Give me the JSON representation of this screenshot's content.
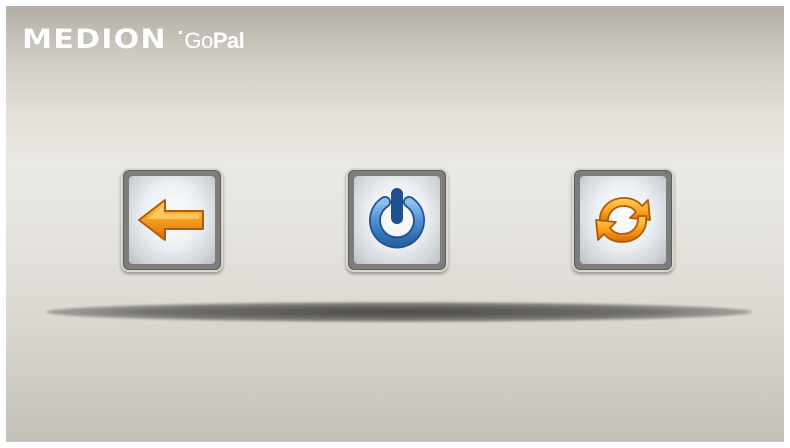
{
  "header": {
    "brand": "MEDION",
    "product_light": "Go",
    "product_bold": "Pal"
  },
  "buttons": [
    {
      "id": "back",
      "icon": "arrow-left-icon",
      "color": "#f29a1c"
    },
    {
      "id": "power",
      "icon": "power-icon",
      "color": "#3f7fc4"
    },
    {
      "id": "restart",
      "icon": "refresh-icon",
      "color": "#f29a1c"
    }
  ],
  "colors": {
    "accent_orange": "#f29a1c",
    "accent_blue": "#3f7fc4",
    "logo": "#ffffff"
  }
}
